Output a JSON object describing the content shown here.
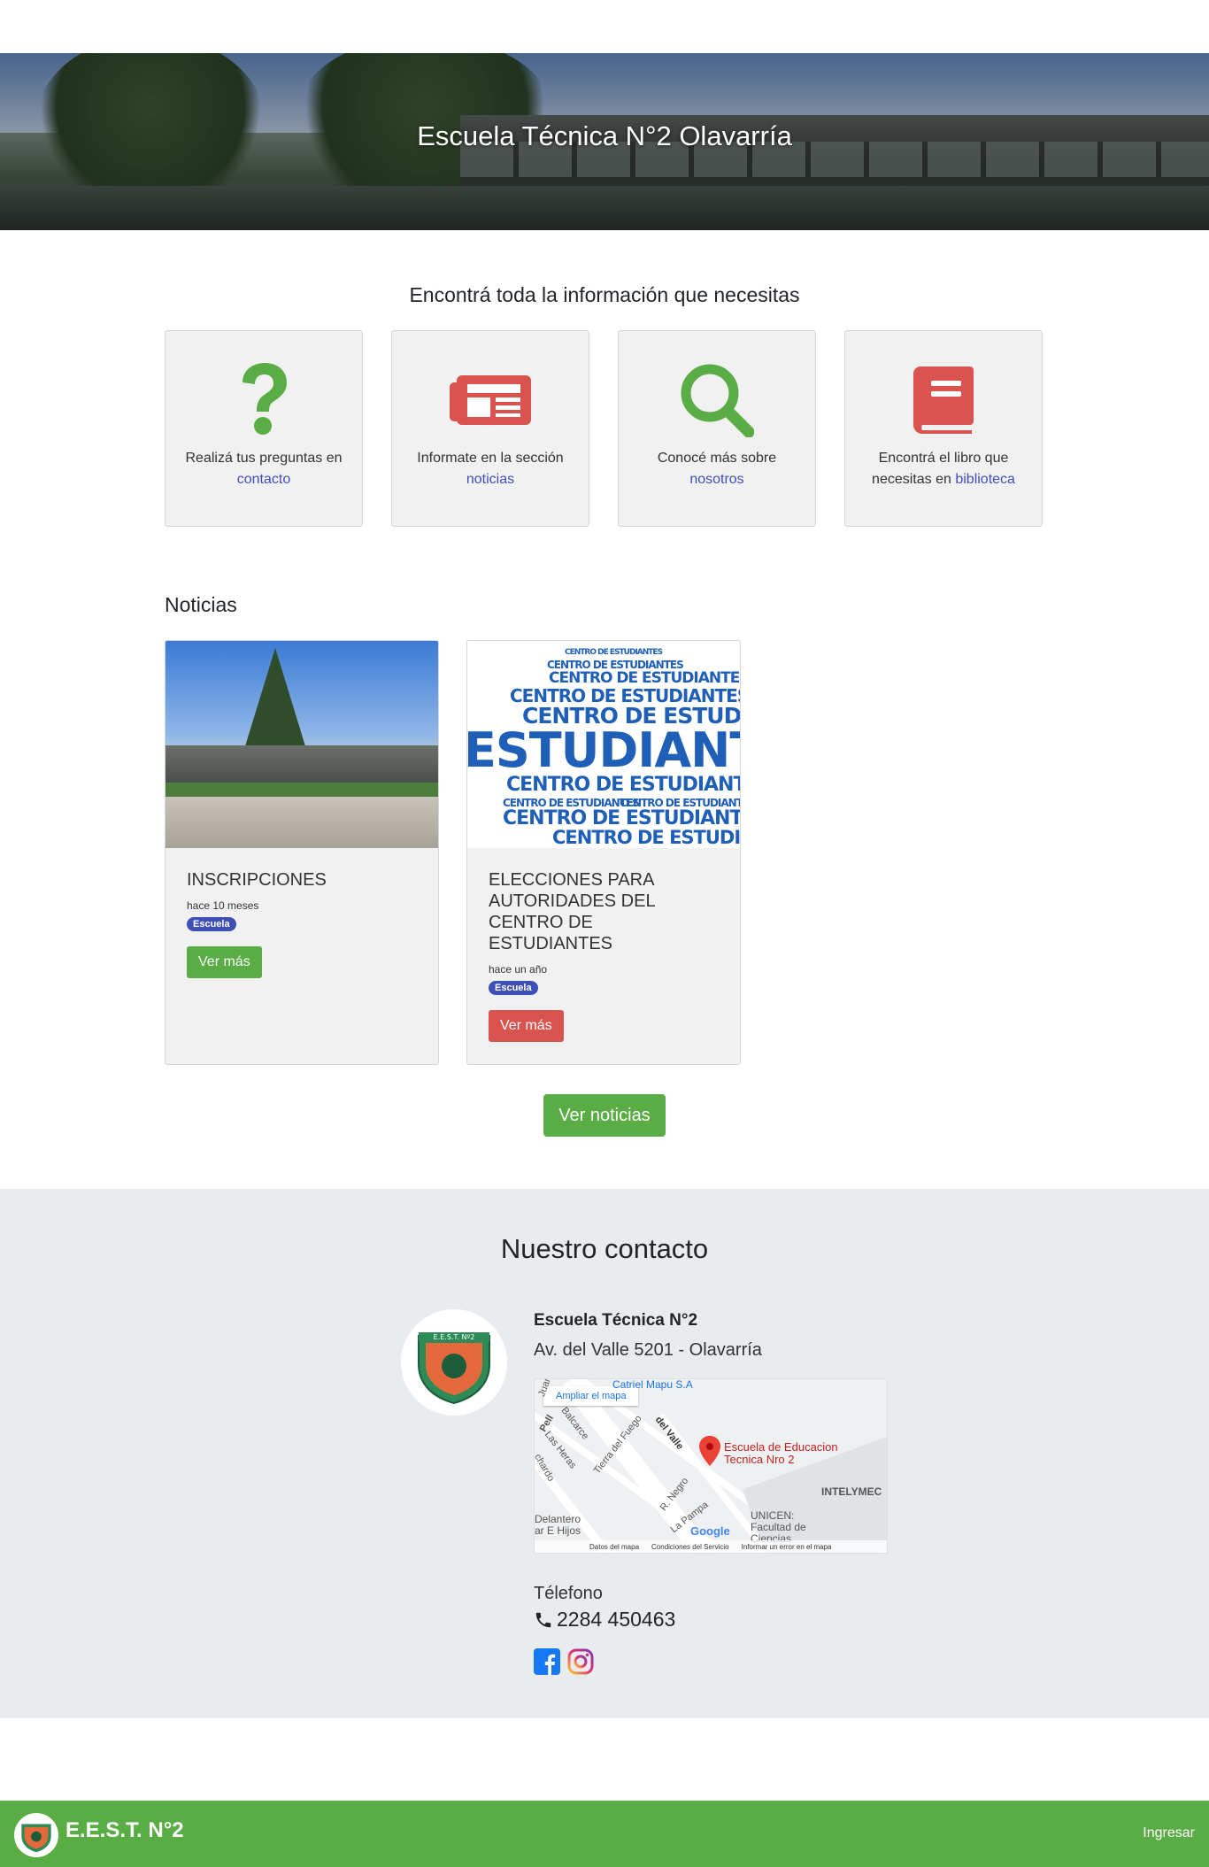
{
  "hero": {
    "title": "Escuela Técnica N°2 Olavarría"
  },
  "info": {
    "heading": "Encontrá toda la información que necesitas",
    "cards": [
      {
        "text": "Realizá tus preguntas en",
        "link": "contacto",
        "icon": "question-icon"
      },
      {
        "text": "Informate en la sección",
        "link": "noticias",
        "icon": "newspaper-icon"
      },
      {
        "text": "Conocé más sobre",
        "link": "nosotros",
        "icon": "search-icon"
      },
      {
        "text": "Encontrá el libro que necesitas en",
        "link": "biblioteca",
        "icon": "book-icon"
      }
    ]
  },
  "news": {
    "heading": "Noticias",
    "items": [
      {
        "title": "INSCRIPCIONES",
        "date": "hace 10 meses",
        "tag": "Escuela",
        "button": "Ver más"
      },
      {
        "title": "ELECCIONES PARA AUTORIDADES DEL CENTRO DE ESTUDIANTES",
        "date": "hace un año",
        "tag": "Escuela",
        "button": "Ver más",
        "image_words": [
          "CENTRO DE ESTUDIANTES",
          "ESTUDIANTES"
        ]
      }
    ],
    "more_button": "Ver noticias"
  },
  "contact": {
    "heading": "Nuestro contacto",
    "logo_text": "E.E.S.T. Nº2",
    "school_name": "Escuela Técnica N°2",
    "address": "Av. del Valle 5201 - Olavarría",
    "map": {
      "expand": "Ampliar el mapa",
      "place_top": "Catriel Mapu S.A",
      "pin": "Escuela de Educacion Tecnica Nro 2",
      "streets": [
        "del Valle",
        "Tierra del Fuego",
        "Las Heras",
        "Balcarce",
        "R. Negro",
        "La Pampa",
        "Juan",
        "Pell",
        "chardo"
      ],
      "pois": [
        "INTELYMEC",
        "UNICEN: Facultad de Ciencias",
        "Delantero ar E Hijos"
      ],
      "google": "Google",
      "footer": [
        "Datos del mapa",
        "Condiciones del Servicio",
        "Informar un error en el mapa"
      ]
    },
    "phone_label": "Télefono",
    "phone": "2284 450463",
    "social": [
      "facebook-icon",
      "instagram-icon"
    ]
  },
  "footer": {
    "brand": "E.E.S.T. N°2",
    "login": "Ingresar"
  },
  "colors": {
    "green": "#5aac44",
    "red": "#d9534f",
    "blue": "#3f4fb8",
    "light": "#e9ecef"
  }
}
